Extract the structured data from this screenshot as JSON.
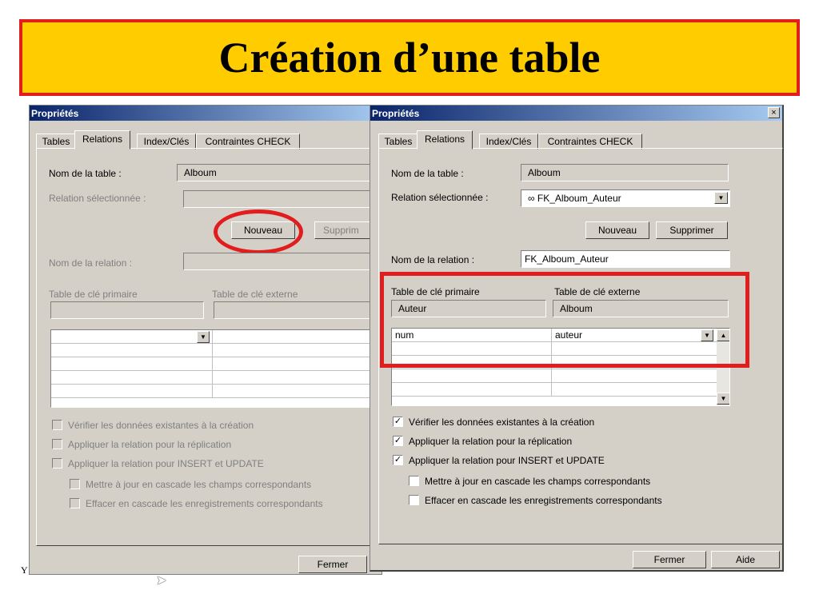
{
  "slide": {
    "title": "Création d’une table",
    "footer_char": "Y"
  },
  "tabs": [
    "Tables",
    "Relations",
    "Index/Clés",
    "Contraintes CHECK"
  ],
  "labels": {
    "table_name": "Nom de la table :",
    "selected_relation": "Relation sélectionnée :",
    "relation_name": "Nom de la relation :",
    "primary_key_table": "Table de clé primaire",
    "foreign_key_table": "Table de clé externe"
  },
  "checks": {
    "verify": "Vérifier les données existantes à la création",
    "replication": "Appliquer la relation pour la réplication",
    "insert_update": "Appliquer la relation pour INSERT et UPDATE",
    "cascade_update": "Mettre à jour en cascade les champs correspondants",
    "cascade_delete": "Effacer en cascade les enregistrements correspondants"
  },
  "buttons": {
    "new": "Nouveau",
    "delete": "Supprimer",
    "close": "Fermer",
    "help": "Aide"
  },
  "dialog_left": {
    "title": "Propriétés",
    "table_name": "Alboum",
    "delete_partial": "Supprim",
    "pk_header_partial": "Table de clé primaire",
    "fk_header_partial": "Table de clé externe"
  },
  "dialog_right": {
    "title": "Propriétés",
    "close_icon": "×",
    "table_name": "Alboum",
    "selected_relation": "FK_Alboum_Auteur",
    "relation_icon": "∞",
    "relation_name": "FK_Alboum_Auteur",
    "primary_table": "Auteur",
    "foreign_table": "Alboum",
    "grid_row": {
      "pk": "num",
      "fk": "auteur"
    },
    "checked": {
      "verify": true,
      "replication": true,
      "insert_update": true,
      "cascade_update": false,
      "cascade_delete": false
    }
  }
}
